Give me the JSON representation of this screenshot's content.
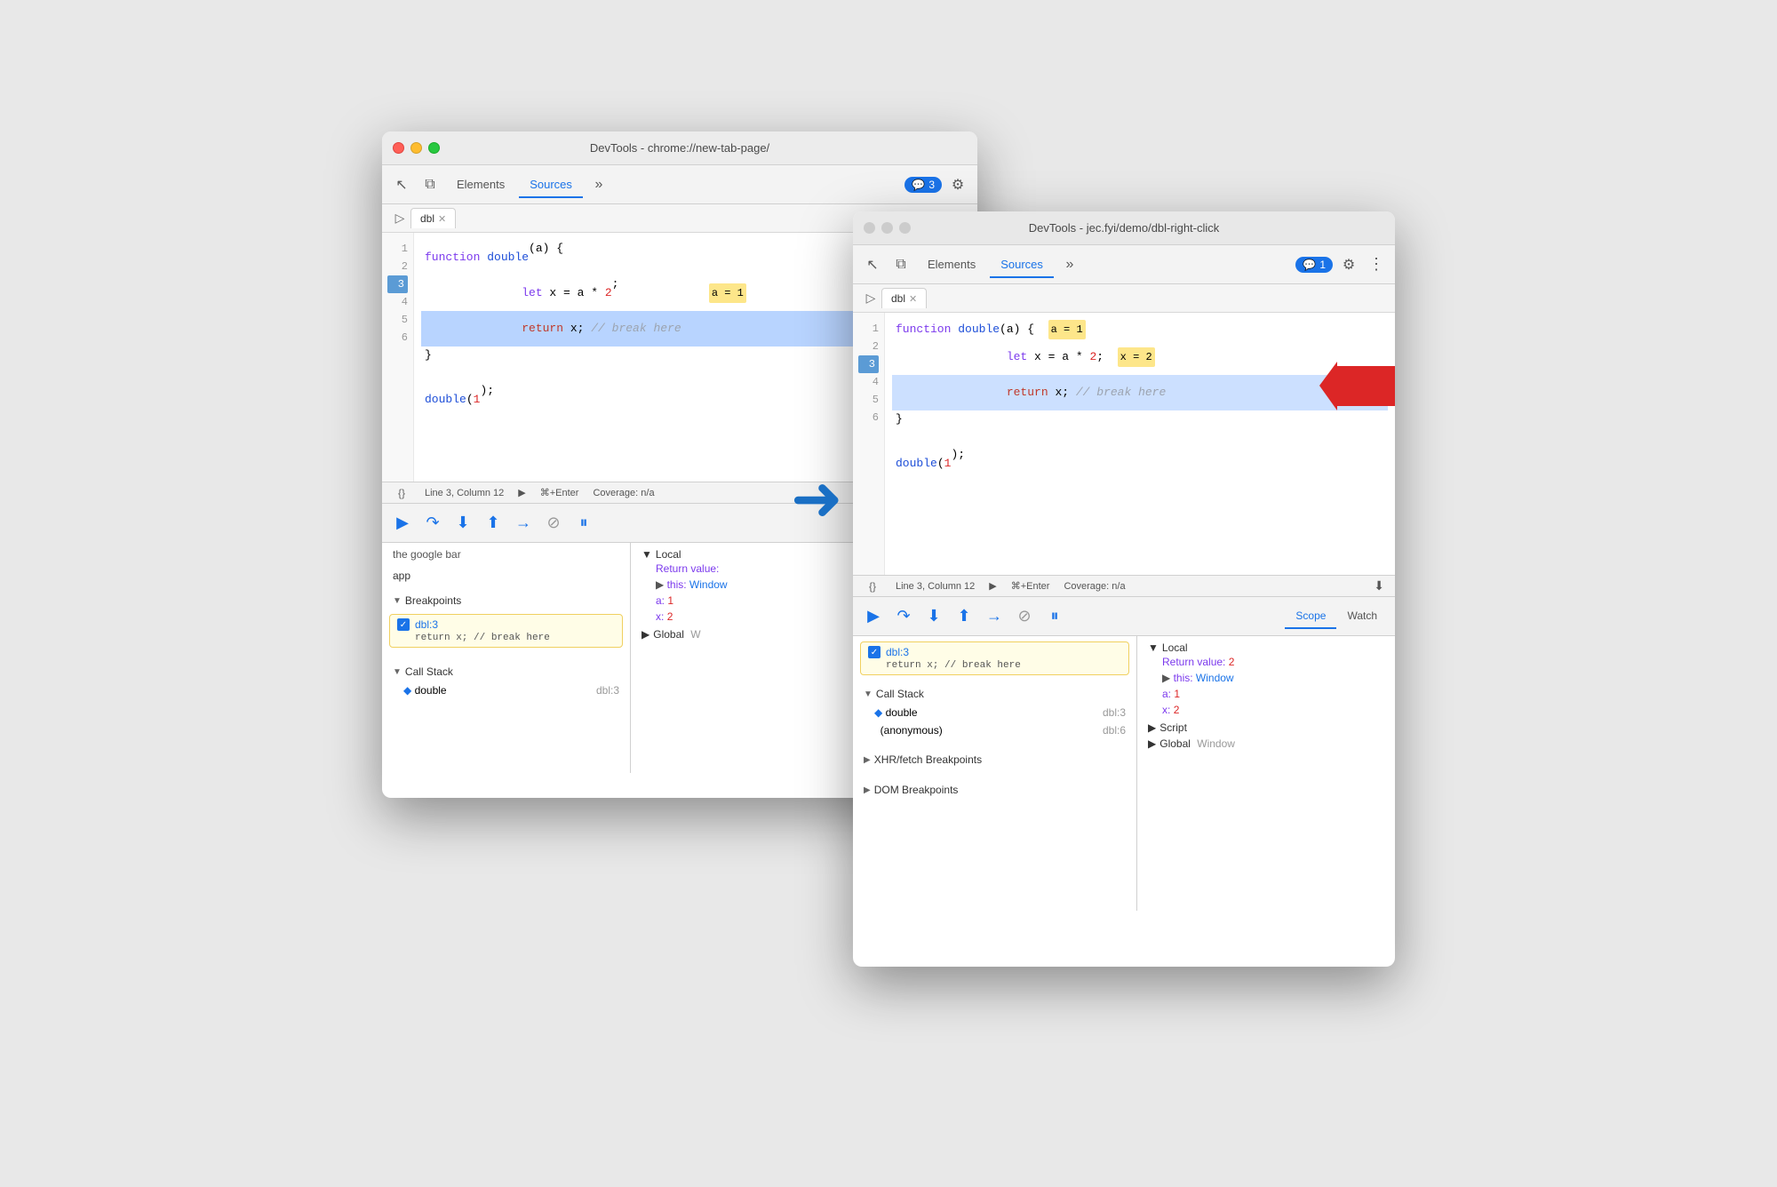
{
  "window_left": {
    "titlebar": "DevTools - chrome://new-tab-page/",
    "tabs": [
      {
        "label": "Elements",
        "active": false
      },
      {
        "label": "Sources",
        "active": true
      }
    ],
    "notification_count": "3",
    "file_tab": "dbl",
    "code_lines": [
      {
        "num": 1,
        "content": "function double(a) {",
        "type": "normal"
      },
      {
        "num": 2,
        "content": "  let x = a * 2;",
        "type": "normal",
        "badge": "a = 1"
      },
      {
        "num": 3,
        "content": "  return x; // break here",
        "type": "highlighted"
      },
      {
        "num": 4,
        "content": "}",
        "type": "normal"
      },
      {
        "num": 5,
        "content": "",
        "type": "normal"
      },
      {
        "num": 6,
        "content": "double(1);",
        "type": "normal"
      }
    ],
    "status_bar": {
      "position": "Line 3, Column 12",
      "shortcut": "⌘+Enter",
      "coverage": "Coverage: n/a"
    },
    "left_panel": {
      "sections": [
        {
          "label": "the google bar",
          "items": [
            "app"
          ]
        },
        {
          "label": "Breakpoints",
          "breakpoints": [
            {
              "id": "dbl:3",
              "code": "return x; // break here"
            }
          ]
        },
        {
          "label": "Call Stack",
          "items": [
            {
              "name": "double",
              "location": "dbl:3"
            }
          ]
        }
      ]
    },
    "right_panel": {
      "tabs": [
        "Scope",
        "Watch"
      ],
      "scope": {
        "local": {
          "header": "Local",
          "items": [
            {
              "key": "Return value:",
              "value": ""
            },
            {
              "key": "▶ this:",
              "value": "Window"
            },
            {
              "key": "a:",
              "value": "1"
            },
            {
              "key": "x:",
              "value": "2"
            }
          ]
        },
        "global": {
          "header": "Global",
          "truncated": "W"
        }
      }
    }
  },
  "window_right": {
    "titlebar": "DevTools - jec.fyi/demo/dbl-right-click",
    "tabs": [
      {
        "label": "Elements",
        "active": false
      },
      {
        "label": "Sources",
        "active": true
      }
    ],
    "notification_count": "1",
    "file_tab": "dbl",
    "code_lines": [
      {
        "num": 1,
        "content": "function double(a) {",
        "type": "normal",
        "badge": "a = 1"
      },
      {
        "num": 2,
        "content": "  let x = a * 2;",
        "type": "normal",
        "badge": "x = 2"
      },
      {
        "num": 3,
        "content": "  return x; // break here",
        "type": "highlighted"
      },
      {
        "num": 4,
        "content": "}",
        "type": "normal"
      },
      {
        "num": 5,
        "content": "",
        "type": "normal"
      },
      {
        "num": 6,
        "content": "double(1);",
        "type": "normal"
      }
    ],
    "status_bar": {
      "position": "Line 3, Column 12",
      "shortcut": "⌘+Enter",
      "coverage": "Coverage: n/a"
    },
    "left_panel": {
      "breakpoint_item": {
        "id": "dbl:3",
        "code": "return x; // break here"
      },
      "call_stack": {
        "header": "Call Stack",
        "items": [
          {
            "name": "double",
            "location": "dbl:3",
            "active": true
          },
          {
            "name": "(anonymous)",
            "location": "dbl:6"
          }
        ]
      },
      "xhr_breakpoints": "XHR/fetch Breakpoints",
      "dom_breakpoints": "DOM Breakpoints"
    },
    "right_panel": {
      "tabs": [
        "Scope",
        "Watch"
      ],
      "scope": {
        "local": {
          "header": "Local",
          "items": [
            {
              "key": "Return value:",
              "value": "2"
            },
            {
              "key": "▶ this:",
              "value": "Window"
            },
            {
              "key": "a:",
              "value": "1"
            },
            {
              "key": "x:",
              "value": "2"
            }
          ]
        },
        "script": {
          "header": "Script"
        },
        "global": {
          "header": "Global",
          "value": "Window"
        }
      }
    }
  },
  "arrow": "➜",
  "icons": {
    "cursor": "↖",
    "layers": "⧉",
    "chevron_right": "»",
    "gear": "⚙",
    "chat": "💬",
    "more": "⋮",
    "play": "▶",
    "resume": "▶",
    "step_over": "↷",
    "step_into": "↓",
    "step_out": "↑",
    "step": "→",
    "deactivate": "⊘",
    "pause": "⏸",
    "arrow_down": "▼",
    "arrow_right": "▶",
    "diamond": "◆"
  }
}
